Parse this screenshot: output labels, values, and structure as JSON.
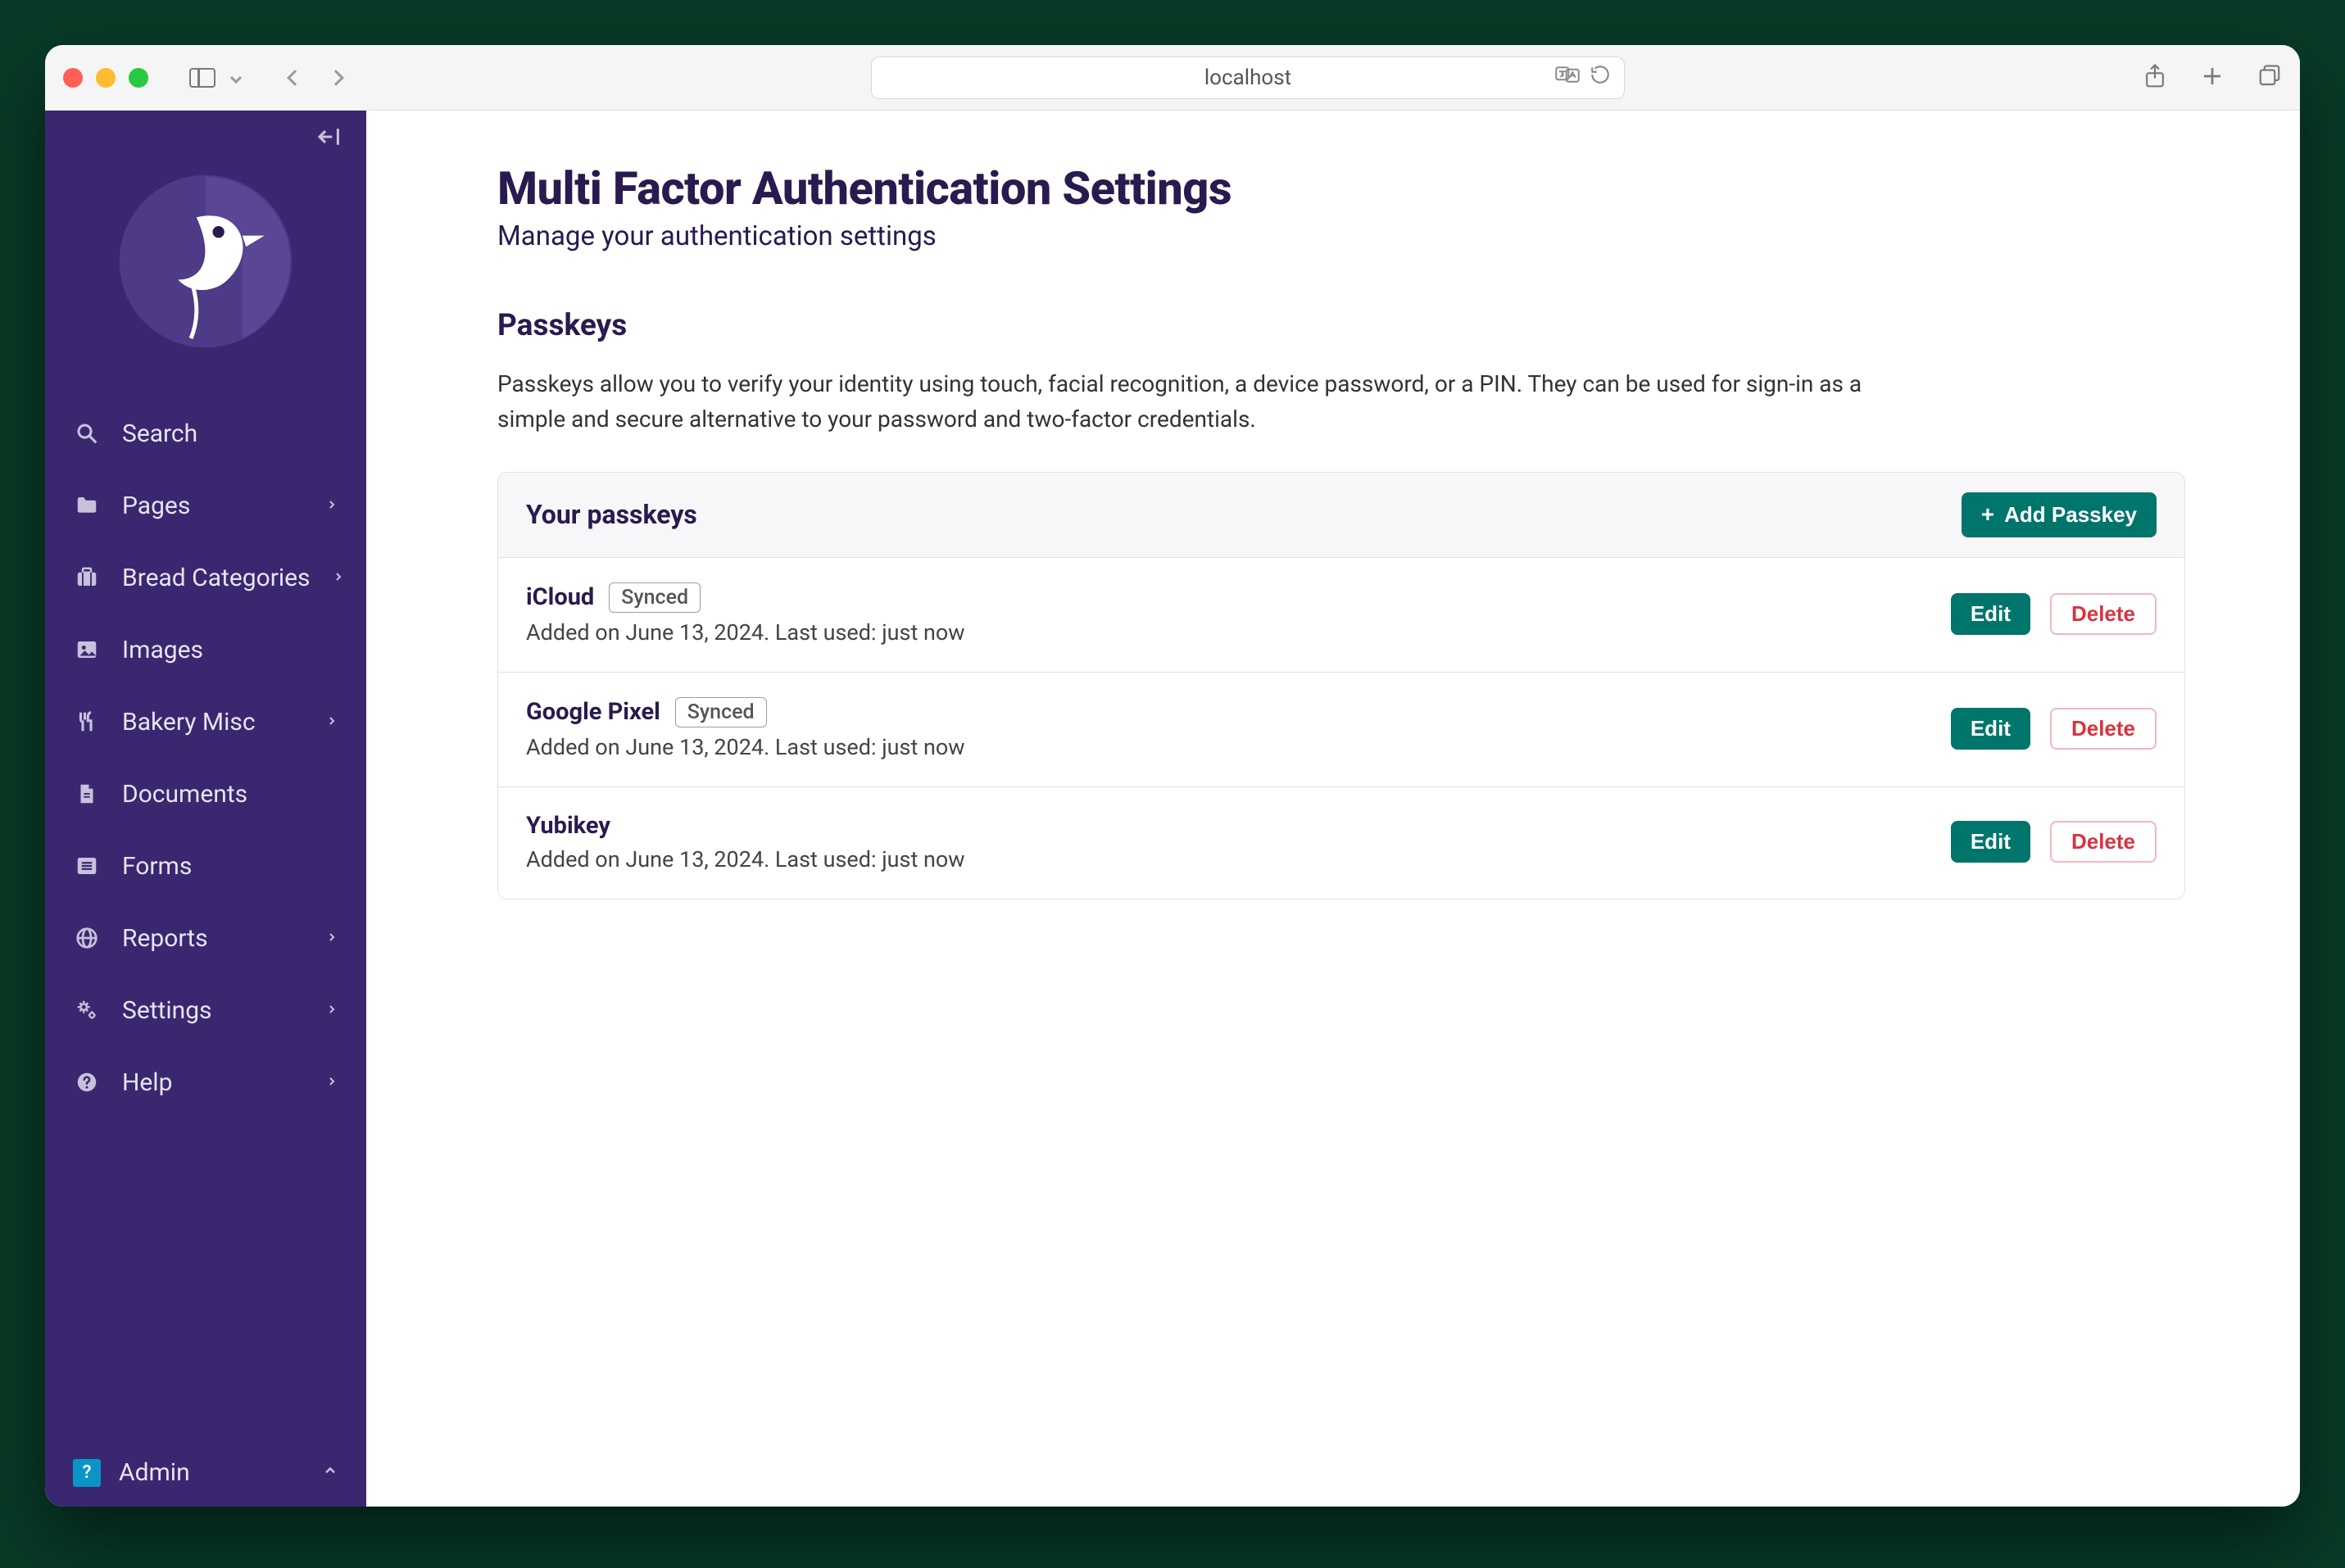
{
  "browser": {
    "address": "localhost"
  },
  "sidebar": {
    "collapse_tooltip": "Collapse",
    "items": [
      {
        "label": "Search",
        "icon": "search-icon",
        "has_children": false
      },
      {
        "label": "Pages",
        "icon": "folder-icon",
        "has_children": true
      },
      {
        "label": "Bread Categories",
        "icon": "suitcase-icon",
        "has_children": true
      },
      {
        "label": "Images",
        "icon": "image-icon",
        "has_children": false
      },
      {
        "label": "Bakery Misc",
        "icon": "utensils-icon",
        "has_children": true
      },
      {
        "label": "Documents",
        "icon": "document-icon",
        "has_children": false
      },
      {
        "label": "Forms",
        "icon": "list-icon",
        "has_children": false
      },
      {
        "label": "Reports",
        "icon": "globe-icon",
        "has_children": true
      },
      {
        "label": "Settings",
        "icon": "gears-icon",
        "has_children": true
      },
      {
        "label": "Help",
        "icon": "help-icon",
        "has_children": true
      }
    ],
    "user": {
      "name": "Admin",
      "avatar_glyph": "?"
    }
  },
  "page": {
    "title": "Multi Factor Authentication Settings",
    "subtitle": "Manage your authentication settings"
  },
  "passkeys": {
    "section_title": "Passkeys",
    "section_desc": "Passkeys allow you to verify your identity using touch, facial recognition, a device password, or a PIN. They can be used for sign-in as a simple and secure alternative to your password and two-factor credentials.",
    "card_title": "Your passkeys",
    "add_label": "Add Passkey",
    "edit_label": "Edit",
    "delete_label": "Delete",
    "synced_tag": "Synced",
    "meta_template": "Added on June 13, 2024. Last used: just now",
    "items": [
      {
        "name": "iCloud",
        "synced": true
      },
      {
        "name": "Google Pixel",
        "synced": true
      },
      {
        "name": "Yubikey",
        "synced": false
      }
    ]
  },
  "colors": {
    "brand_dark": "#291a4f",
    "sidebar_bg": "#3a2770",
    "teal": "#00756c",
    "danger": "#d9333f"
  }
}
